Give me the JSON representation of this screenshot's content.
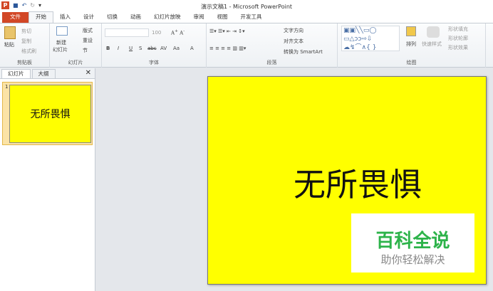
{
  "window": {
    "title": "演示文稿1 - Microsoft PowerPoint",
    "app_icon": "P"
  },
  "tabs": [
    "文件",
    "开始",
    "插入",
    "设计",
    "切换",
    "动画",
    "幻灯片放映",
    "审阅",
    "视图",
    "开发工具"
  ],
  "ribbon": {
    "clipboard": {
      "label": "剪贴板",
      "paste": "粘贴",
      "cut": "剪切",
      "copy": "复制",
      "format_painter": "格式刷"
    },
    "slides": {
      "label": "幻灯片",
      "new_slide": "新建",
      "new_slide2": "幻灯片",
      "layout": "版式",
      "reset": "重设",
      "section": "节"
    },
    "font": {
      "label": "字体",
      "size": "100",
      "bold": "B",
      "italic": "I",
      "underline": "U",
      "shadow": "S",
      "strike": "abc",
      "spacing": "AV",
      "case": "Aa",
      "color": "A"
    },
    "paragraph": {
      "label": "段落",
      "text_direction": "文字方向",
      "align_text": "对齐文本",
      "smartart": "转换为 SmartArt"
    },
    "drawing": {
      "label": "绘图",
      "arrange": "排列",
      "quick_styles": "快速样式",
      "fill": "形状填充",
      "outline": "形状轮廓",
      "effects": "形状效果"
    }
  },
  "pane": {
    "tabs": [
      "幻灯片",
      "大纲"
    ],
    "slide_number": "1",
    "thumb_text": "无所畏惧"
  },
  "slide": {
    "text": "无所畏惧",
    "bg": "#ffff00"
  },
  "watermark": {
    "title": "百科全说",
    "subtitle": "助你轻松解决"
  }
}
